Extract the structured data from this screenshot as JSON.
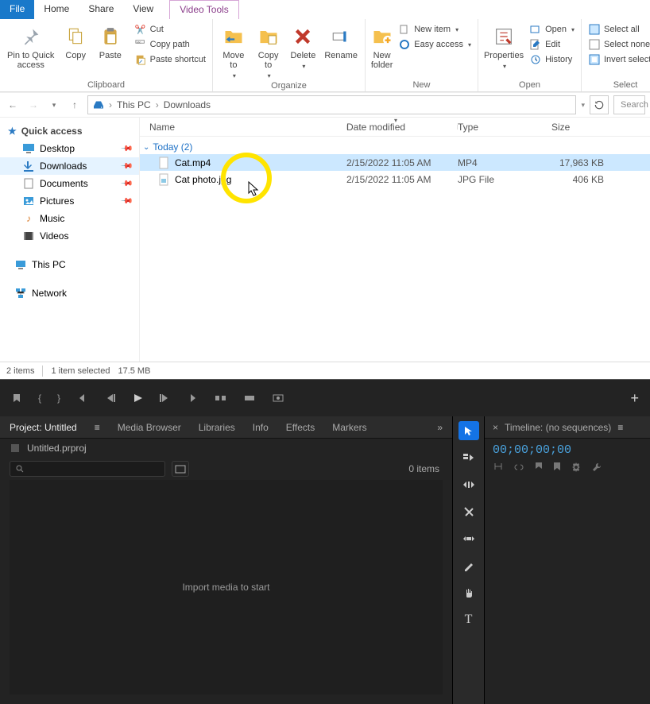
{
  "tabs": {
    "file": "File",
    "home": "Home",
    "share": "Share",
    "view": "View",
    "context": "Video Tools"
  },
  "ribbon": {
    "clipboard": {
      "label": "Clipboard",
      "pin": "Pin to Quick\naccess",
      "copy": "Copy",
      "paste": "Paste",
      "cut": "Cut",
      "copy_path": "Copy path",
      "paste_shortcut": "Paste shortcut"
    },
    "organize": {
      "label": "Organize",
      "move": "Move\nto",
      "copy": "Copy\nto",
      "delete": "Delete",
      "rename": "Rename"
    },
    "new": {
      "label": "New",
      "new_folder": "New\nfolder",
      "new_item": "New item",
      "easy_access": "Easy access"
    },
    "open": {
      "label": "Open",
      "properties": "Properties",
      "open": "Open",
      "edit": "Edit",
      "history": "History"
    },
    "select": {
      "label": "Select",
      "all": "Select all",
      "none": "Select none",
      "invert": "Invert selection"
    }
  },
  "breadcrumbs": {
    "root": "This PC",
    "leaf": "Downloads"
  },
  "search_placeholder": "Search",
  "sidebar": {
    "quick": "Quick access",
    "items": [
      {
        "label": "Desktop"
      },
      {
        "label": "Downloads"
      },
      {
        "label": "Documents"
      },
      {
        "label": "Pictures"
      },
      {
        "label": "Music"
      },
      {
        "label": "Videos"
      }
    ],
    "this_pc": "This PC",
    "network": "Network"
  },
  "columns": {
    "name": "Name",
    "date": "Date modified",
    "type": "Type",
    "size": "Size"
  },
  "group_label": "Today (2)",
  "files": [
    {
      "name": "Cat.mp4",
      "date": "2/15/2022 11:05 AM",
      "type": "MP4",
      "size": "17,963 KB"
    },
    {
      "name": "Cat photo.jpg",
      "date": "2/15/2022 11:05 AM",
      "type": "JPG File",
      "size": "406 KB"
    }
  ],
  "status": {
    "count": "2 items",
    "sel": "1 item selected",
    "size": "17.5 MB"
  },
  "premiere": {
    "panels": {
      "project": "Project: Untitled",
      "media": "Media Browser",
      "lib": "Libraries",
      "info": "Info",
      "fx": "Effects",
      "markers": "Markers"
    },
    "project_file": "Untitled.prproj",
    "bin_count": "0 items",
    "dropzone": "Import media to start",
    "timeline_label": "Timeline: (no sequences)",
    "timecode": "00;00;00;00"
  }
}
